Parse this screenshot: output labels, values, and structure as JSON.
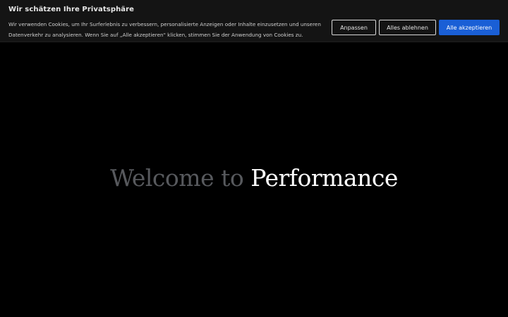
{
  "cookie_banner": {
    "title": "Wir schätzen Ihre Privatsphäre",
    "text": "Wir verwenden Cookies, um Ihr Surferlebnis zu verbessern, personalisierte Anzeigen oder Inhalte einzusetzen und unseren Datenverkehr zu analysieren. Wenn Sie auf „Alle akzeptieren\" klicken, stimmen Sie der Anwendung von Cookies zu.",
    "customize_label": "Anpassen",
    "reject_label": "Alles ablehnen",
    "accept_label": "Alle akzeptieren",
    "accent_color": "#1a5fd6"
  },
  "hero": {
    "prefix": "Welcome to",
    "highlight": "Performance"
  }
}
